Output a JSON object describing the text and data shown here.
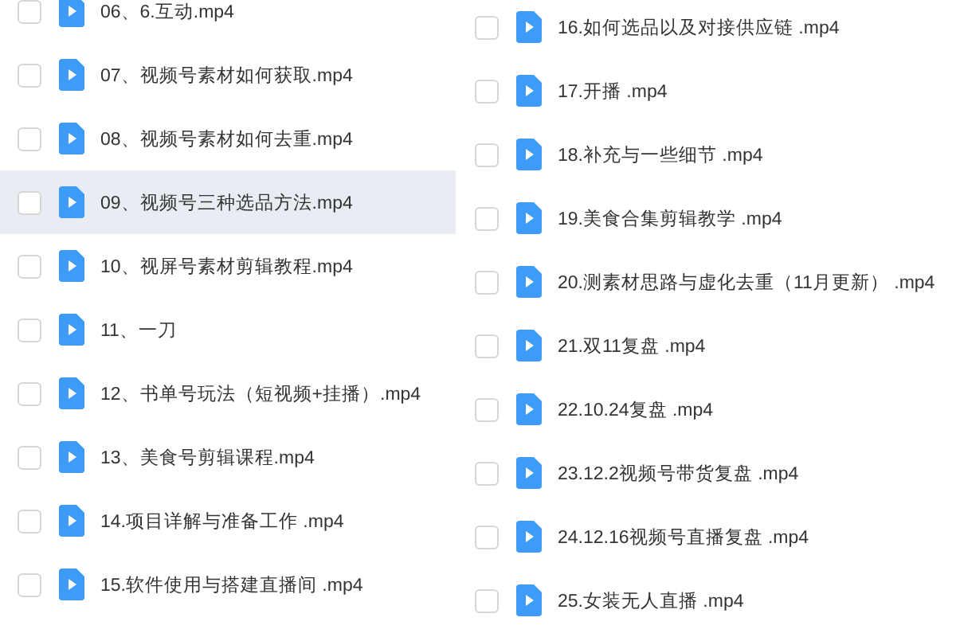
{
  "columns": [
    {
      "files": [
        {
          "name": "06、6.互动.mp4",
          "checked": false,
          "selected": false
        },
        {
          "name": "07、视频号素材如何获取.mp4",
          "checked": false,
          "selected": false
        },
        {
          "name": "08、视频号素材如何去重.mp4",
          "checked": false,
          "selected": false
        },
        {
          "name": "09、视频号三种选品方法.mp4",
          "checked": false,
          "selected": true
        },
        {
          "name": "10、视屏号素材剪辑教程.mp4",
          "checked": false,
          "selected": false
        },
        {
          "name": "11、一刀",
          "checked": false,
          "selected": false
        },
        {
          "name": "12、书单号玩法（短视频+挂播）.mp4",
          "checked": false,
          "selected": false
        },
        {
          "name": "13、美食号剪辑课程.mp4",
          "checked": false,
          "selected": false
        },
        {
          "name": "14.项目详解与准备工作 .mp4",
          "checked": false,
          "selected": false
        },
        {
          "name": "15.软件使用与搭建直播间 .mp4",
          "checked": false,
          "selected": false
        }
      ]
    },
    {
      "files": [
        {
          "name": "16.如何选品以及对接供应链 .mp4",
          "checked": false,
          "selected": false
        },
        {
          "name": "17.开播 .mp4",
          "checked": false,
          "selected": false
        },
        {
          "name": "18.补充与一些细节 .mp4",
          "checked": false,
          "selected": false
        },
        {
          "name": "19.美食合集剪辑教学 .mp4",
          "checked": false,
          "selected": false
        },
        {
          "name": "20.测素材思路与虚化去重（11月更新） .mp4",
          "checked": false,
          "selected": false
        },
        {
          "name": "21.双11复盘 .mp4",
          "checked": false,
          "selected": false
        },
        {
          "name": "22.10.24复盘 .mp4",
          "checked": false,
          "selected": false
        },
        {
          "name": "23.12.2视频号带货复盘 .mp4",
          "checked": false,
          "selected": false
        },
        {
          "name": "24.12.16视频号直播复盘 .mp4",
          "checked": false,
          "selected": false
        },
        {
          "name": "25.女装无人直播 .mp4",
          "checked": false,
          "selected": false
        }
      ]
    }
  ]
}
